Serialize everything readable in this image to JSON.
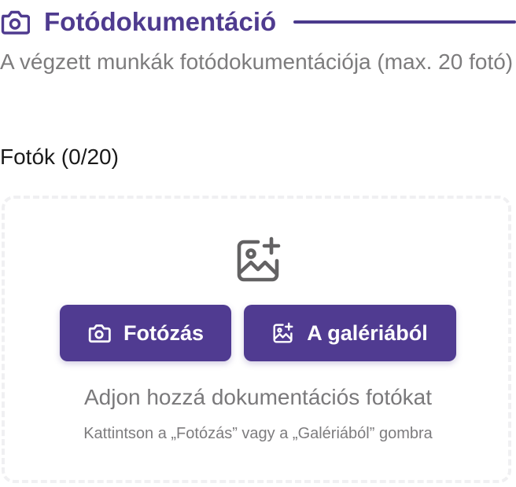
{
  "section": {
    "title": "Fotódokumentáció",
    "icon": "camera-icon",
    "accent_color": "#4f3b8f",
    "subtitle": "A végzett munkák fotódokumentációja (max. 20 fotó)"
  },
  "photos": {
    "count_label": "Fotók (0/20)",
    "empty_icon": "image-plus-icon"
  },
  "buttons": {
    "camera_label": "Fotózás",
    "camera_icon": "camera-icon",
    "gallery_label": "A galériából",
    "gallery_icon": "image-plus-icon",
    "color": "#503b91"
  },
  "empty_state": {
    "title": "Adjon hozzá dokumentációs fotókat",
    "hint": "Kattintson a „Fotózás” vagy a „Galériából” gombra"
  }
}
